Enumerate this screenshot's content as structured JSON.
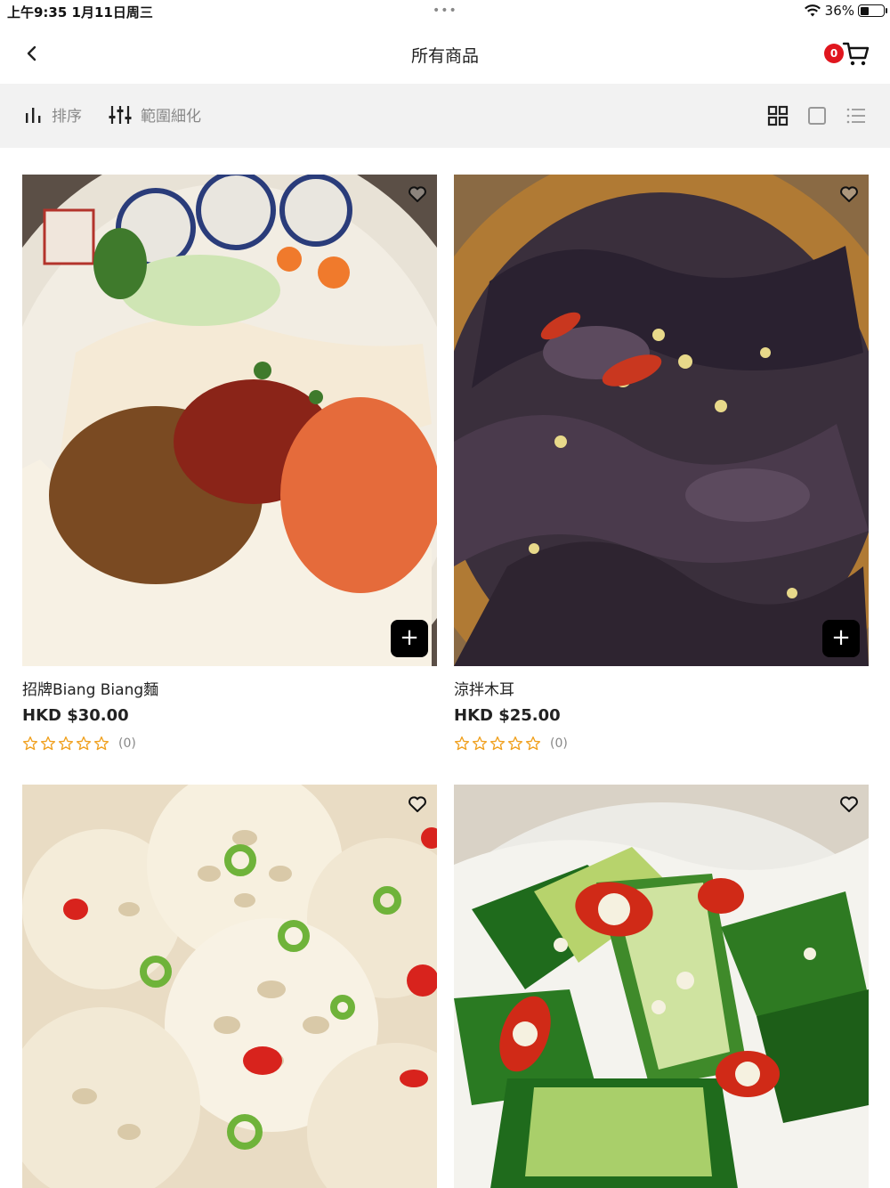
{
  "status_bar": {
    "time": "上午9:35   1月11日周三",
    "dots": "•••",
    "battery_text": "36%",
    "battery_level": 0.36
  },
  "nav": {
    "title": "所有商品",
    "cart_count": "0"
  },
  "toolbar": {
    "sort_label": "排序",
    "filter_label": "範圍細化"
  },
  "products": [
    {
      "name": "招牌Biang Biang麵",
      "price": "HKD $30.00",
      "rating_count": "(0)",
      "rating": 0,
      "image": "biang-biang-noodle-bowl"
    },
    {
      "name": "涼拌木耳",
      "price": "HKD $25.00",
      "rating_count": "(0)",
      "rating": 0,
      "image": "wood-ear-fungus-salad"
    },
    {
      "name": "",
      "price": "",
      "rating_count": "",
      "rating": 0,
      "image": "lotus-root-slices"
    },
    {
      "name": "",
      "price": "",
      "rating_count": "",
      "rating": 0,
      "image": "smashed-cucumber-salad"
    }
  ],
  "icons": {
    "back": "chevron-left-icon",
    "cart": "cart-icon",
    "sort": "bar-chart-icon",
    "filter": "sliders-icon",
    "grid_view": "grid-icon",
    "single_view": "square-icon",
    "list_view": "list-icon",
    "wishlist": "heart-icon",
    "add": "plus-icon",
    "star": "star-outline-icon"
  },
  "colors": {
    "badge": "#e0161e",
    "star": "#f0a01e",
    "toolbar_bg": "#f2f2f2"
  }
}
